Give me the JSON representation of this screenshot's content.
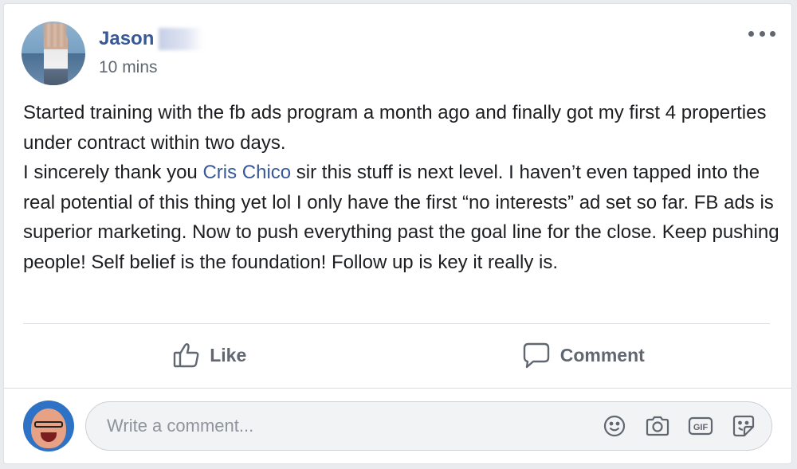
{
  "post": {
    "author_name": "Jason",
    "timestamp": "10 mins",
    "text_part1": "Started training with the fb ads program a month ago and finally got my first 4 properties under contract within two days.",
    "text_part2": "I sincerely thank you ",
    "mention": "Cris Chico",
    "text_part3": " sir this stuff is next level. I haven’t even tapped into the real potential of this thing yet lol I only have the first “no interests” ad set so far. FB ads is superior marketing. Now to push everything past the goal line for the close. Keep pushing people! Self belief is the foundation! Follow up is key it really is."
  },
  "actions": {
    "like_label": "Like",
    "comment_label": "Comment"
  },
  "composer": {
    "placeholder": "Write a comment...",
    "icons": [
      "emoji-icon",
      "camera-icon",
      "gif-icon",
      "sticker-icon"
    ]
  },
  "colors": {
    "link": "#385898",
    "secondary_text": "#606770",
    "body_text": "#1c1e21"
  }
}
